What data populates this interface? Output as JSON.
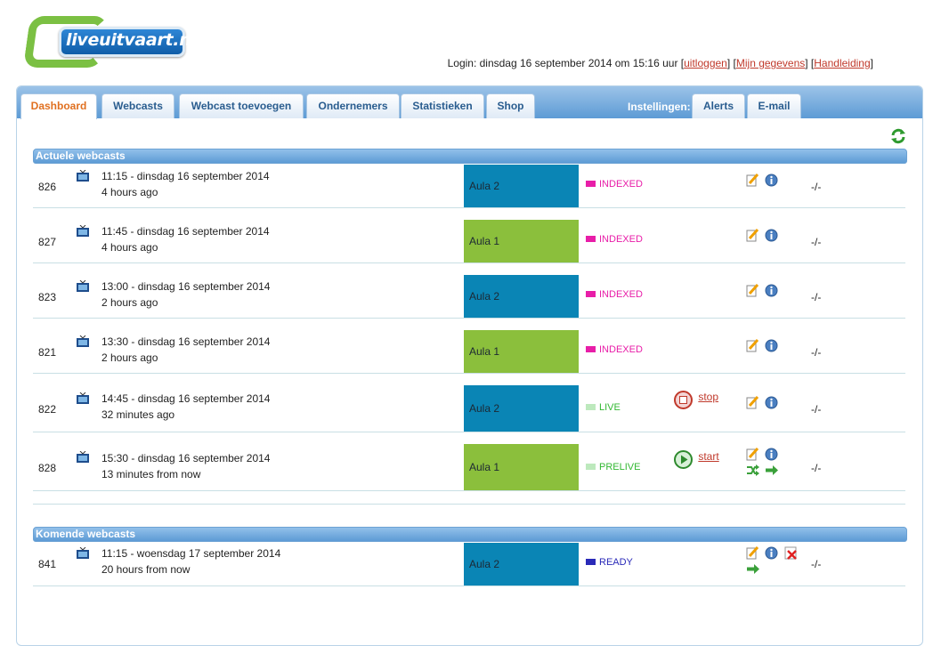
{
  "logo": {
    "text": "liveuitvaart.nl"
  },
  "login": {
    "prefix": "Login: dinsdag 16 september 2014 om 15:16 uur",
    "logout": "uitloggen",
    "mydata": "Mijn gegevens",
    "manual": "Handleiding"
  },
  "tabs": [
    {
      "label": "Dashboard",
      "active": true
    },
    {
      "label": "Webcasts"
    },
    {
      "label": "Webcast toevoegen"
    },
    {
      "label": "Ondernemers"
    },
    {
      "label": "Statistieken"
    },
    {
      "label": "Shop"
    }
  ],
  "settings": {
    "label": "Instellingen:",
    "tabs": [
      {
        "label": "Alerts"
      },
      {
        "label": "E-mail"
      }
    ]
  },
  "sections": {
    "current": "Actuele webcasts",
    "upcoming": "Komende webcasts"
  },
  "colors": {
    "indexed": "#e81ea8",
    "live": "#33b833",
    "prelive": "#33b833",
    "ready": "#2a2ab8",
    "room_blue": "#0a85b5",
    "room_green": "#8bbf3c"
  },
  "current_webcasts": [
    {
      "id": "826",
      "datetime": "11:15 - dinsdag 16 september 2014",
      "relative": "4 hours ago",
      "room": "Aula 2",
      "status": "INDEXED",
      "action": "",
      "dash": "-/-"
    },
    {
      "id": "827",
      "datetime": "11:45 - dinsdag 16 september 2014",
      "relative": "4 hours ago",
      "room": "Aula 1",
      "status": "INDEXED",
      "action": "",
      "dash": "-/-"
    },
    {
      "id": "823",
      "datetime": "13:00 - dinsdag 16 september 2014",
      "relative": "2 hours ago",
      "room": "Aula 2",
      "status": "INDEXED",
      "action": "",
      "dash": "-/-"
    },
    {
      "id": "821",
      "datetime": "13:30 - dinsdag 16 september 2014",
      "relative": "2 hours ago",
      "room": "Aula 1",
      "status": "INDEXED",
      "action": "",
      "dash": "-/-"
    },
    {
      "id": "822",
      "datetime": "14:45 - dinsdag 16 september 2014",
      "relative": "32 minutes ago",
      "room": "Aula 2",
      "status": "LIVE",
      "action": "stop",
      "dash": "-/-"
    },
    {
      "id": "828",
      "datetime": "15:30 - dinsdag 16 september 2014",
      "relative": "13 minutes from now",
      "room": "Aula 1",
      "status": "PRELIVE",
      "action": "start",
      "dash": "-/-"
    }
  ],
  "upcoming_webcasts": [
    {
      "id": "841",
      "datetime": "11:15 - woensdag 17 september 2014",
      "relative": "20 hours from now",
      "room": "Aula 2",
      "status": "READY",
      "action": "",
      "dash": "-/-"
    }
  ],
  "icons": {
    "tv": "tv-icon",
    "edit": "edit-icon",
    "info": "info-icon",
    "delete": "delete-icon",
    "move": "shuffle-icon",
    "arrow": "arrow-right-icon",
    "refresh": "refresh-icon",
    "stop": "stop-icon",
    "start": "play-icon"
  }
}
